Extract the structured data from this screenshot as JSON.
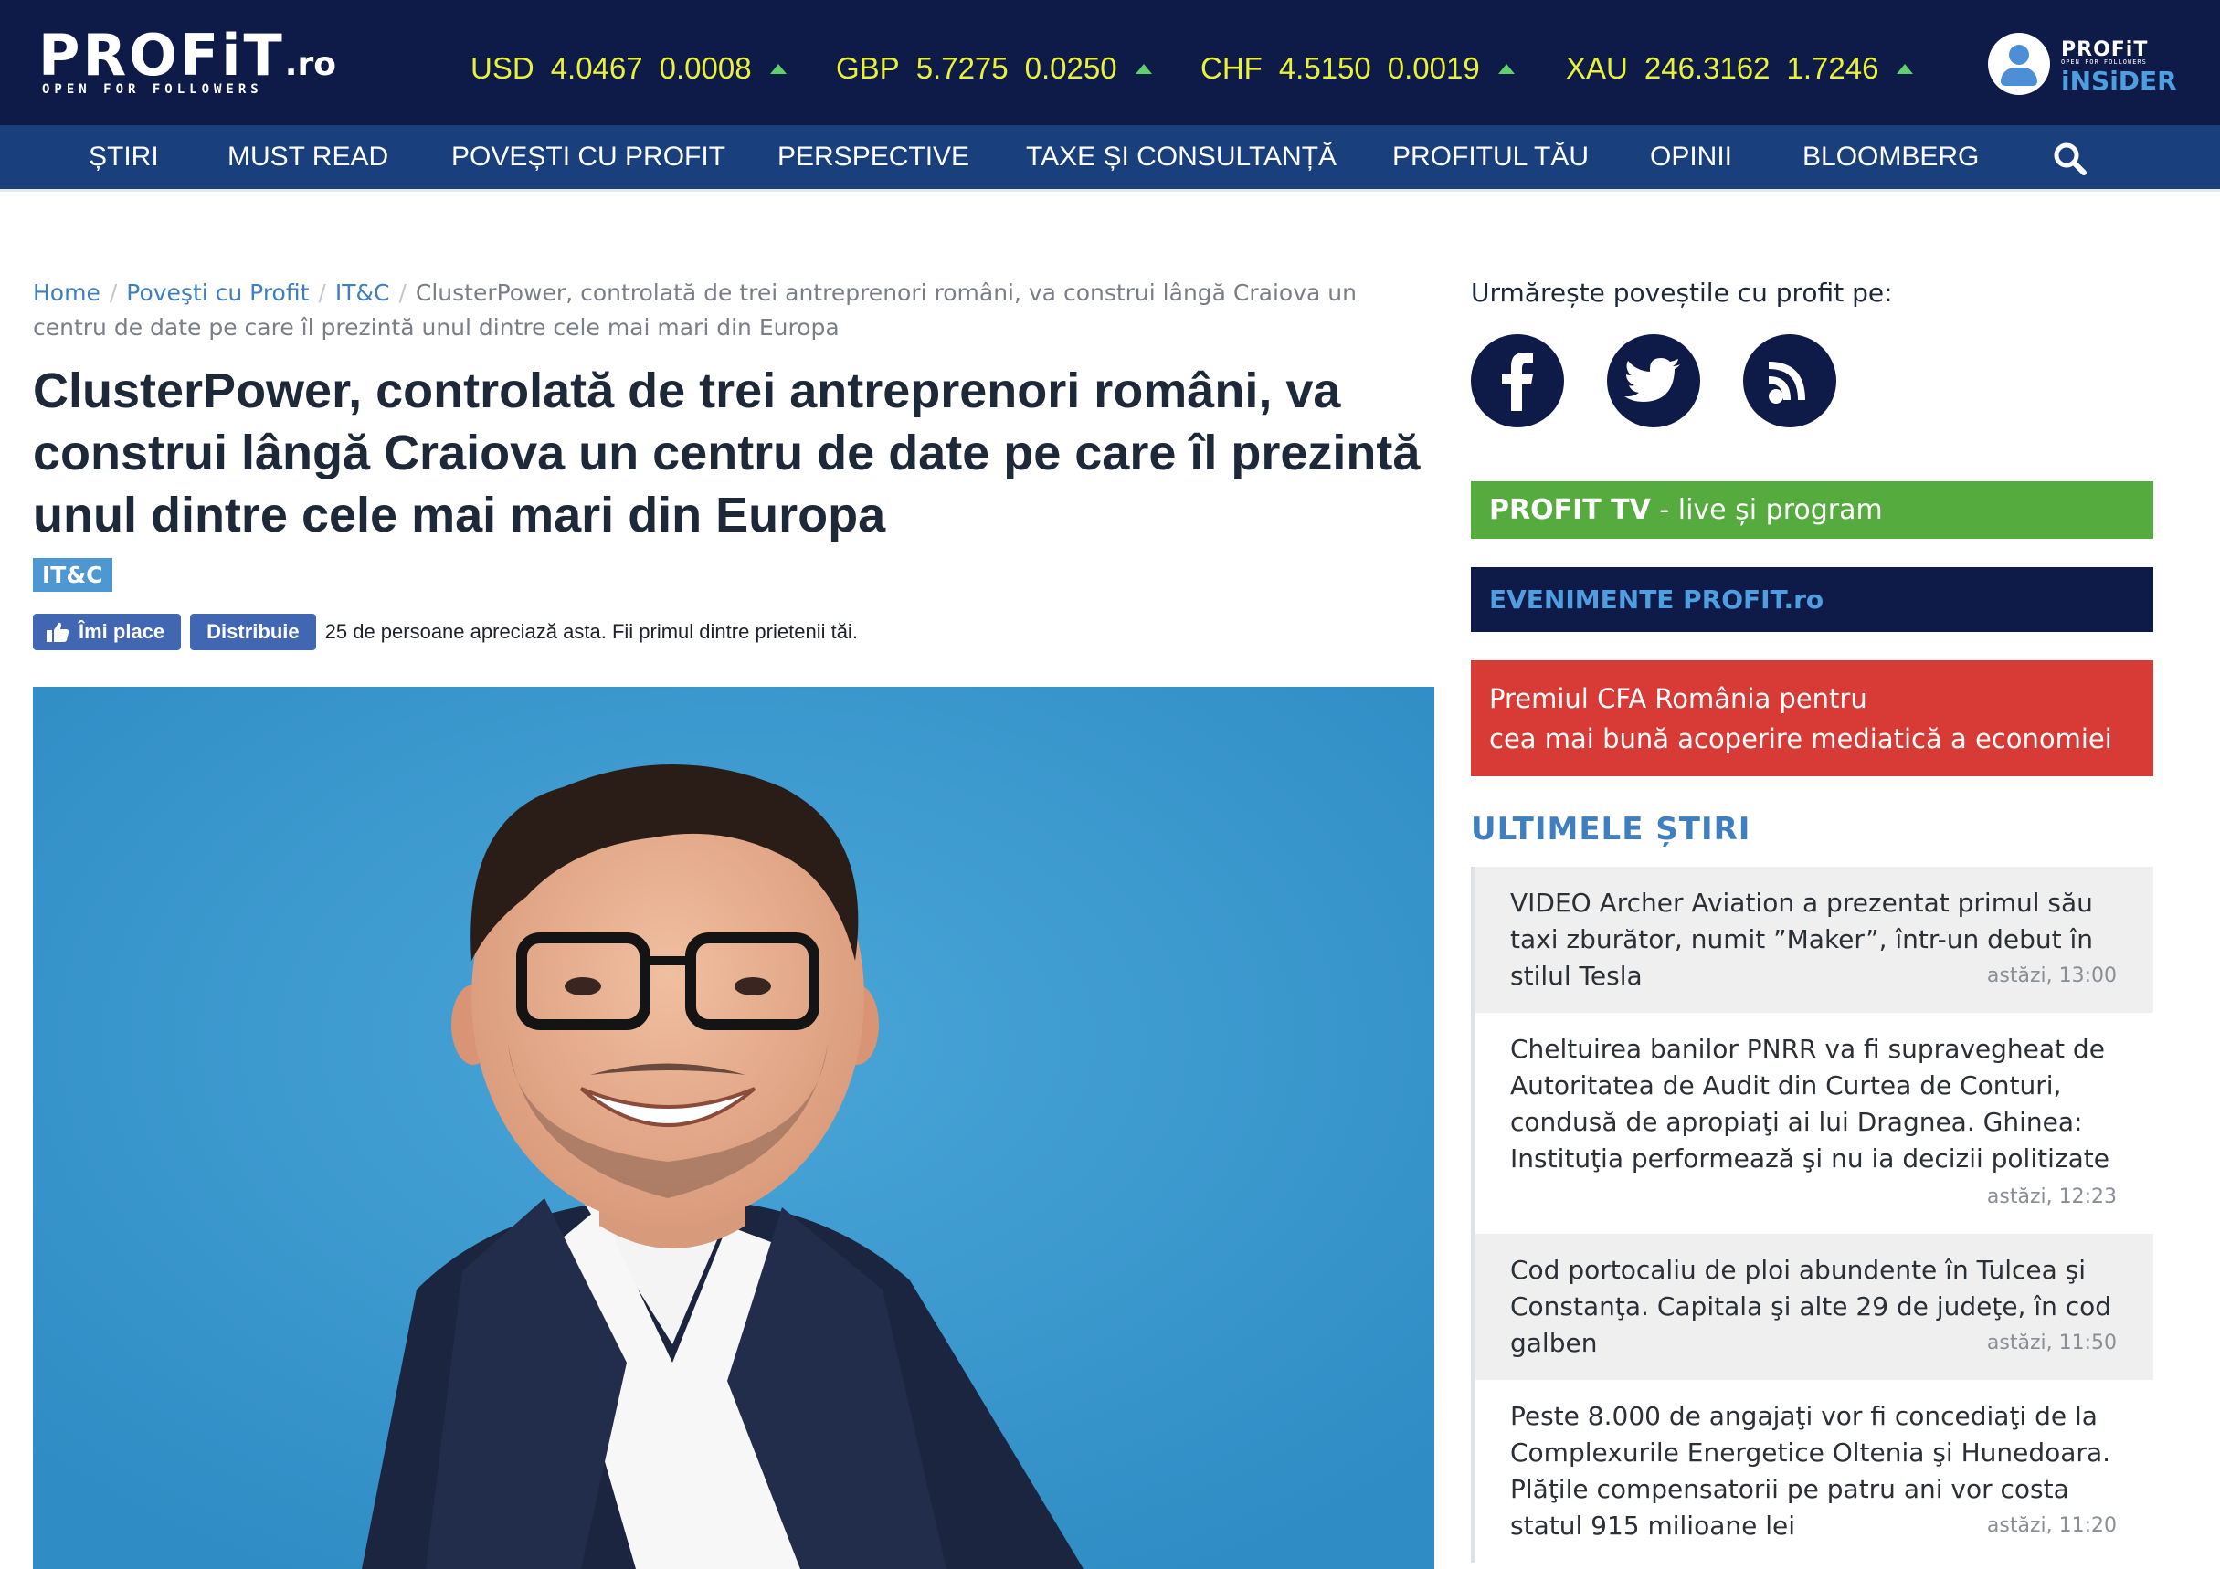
{
  "header": {
    "logo_main": "PROFiT",
    "logo_suffix": ".ro",
    "logo_tagline": "OPEN FOR FOLLOWERS",
    "tickers": [
      {
        "symbol": "USD",
        "value": "4.0467",
        "change": "0.0008"
      },
      {
        "symbol": "GBP",
        "value": "5.7275",
        "change": "0.0250"
      },
      {
        "symbol": "CHF",
        "value": "4.5150",
        "change": "0.0019"
      },
      {
        "symbol": "XAU",
        "value": "246.3162",
        "change": "1.7246"
      }
    ],
    "insider": {
      "line1": "PROFiT",
      "line2": "OPEN FOR FOLLOWERS",
      "line3": "iNSiDER"
    }
  },
  "nav": {
    "items": [
      "ȘTIRI",
      "MUST READ",
      "POVEȘTI CU PROFIT",
      "PERSPECTIVE",
      "TAXE ȘI CONSULTANȚĂ",
      "PROFITUL TĂU",
      "OPINII",
      "BLOOMBERG"
    ]
  },
  "breadcrumb": {
    "items": [
      "Home",
      "Poveşti cu Profit",
      "IT&C"
    ],
    "current": "ClusterPower, controlată de trei antreprenori români, va construi lângă Craiova un centru de date pe care îl prezintă unul dintre cele mai mari din Europa"
  },
  "article": {
    "title": "ClusterPower, controlată de trei antreprenori români, va construi lângă Craiova un centru de date pe care îl prezintă unul dintre cele mai mari din Europa",
    "category": "IT&C",
    "like_label": "Îmi place",
    "share_label": "Distribuie",
    "like_text": "25 de persoane apreciază asta. Fii primul dintre prietenii tăi."
  },
  "sidebar": {
    "follow_title": "Urmărește poveștile cu profit pe:",
    "profit_tv_bold": "PROFIT TV",
    "profit_tv_rest": " - live și program",
    "events": "EVENIMENTE PROFIT.ro",
    "cfa_line1": "Premiul CFA România pentru",
    "cfa_line2": "cea mai bună acoperire mediatică a economiei",
    "latest_title": "ULTIMELE ȘTIRI",
    "news": [
      {
        "text": "VIDEO Archer Aviation a prezentat primul său taxi zburător, numit ”Maker”, într-un debut în stilul Tesla",
        "time": "astăzi, 13:00"
      },
      {
        "text": "Cheltuirea banilor PNRR va fi supravegheat de Autoritatea de Audit din Curtea de Conturi, condusă de apropiaţi ai lui Dragnea. Ghinea: Instituţia performează şi nu ia decizii politizate",
        "time": "astăzi, 12:23"
      },
      {
        "text": "Cod portocaliu de ploi abundente în Tulcea şi Constanţa. Capitala şi alte 29 de judeţe, în cod galben",
        "time": "astăzi, 11:50"
      },
      {
        "text": "Peste 8.000 de angajaţi vor fi concediaţi de la Complexurile Energetice Oltenia şi Hunedoara. Plăţile compensatorii pe patru ani vor costa statul 915 milioane lei",
        "time": "astăzi, 11:20"
      }
    ]
  },
  "colors": {
    "topbar": "#0e1a47",
    "nav": "#1a3f7d",
    "ticker": "#e9f13a",
    "profit_tv": "#55ab3d",
    "cfa": "#d83a36",
    "link": "#3f7fc0"
  },
  "icons": {
    "search": "search-icon",
    "facebook": "facebook-icon",
    "twitter": "twitter-icon",
    "rss": "rss-icon",
    "like": "thumbs-up-icon",
    "up_arrow": "triangle-up-icon"
  }
}
